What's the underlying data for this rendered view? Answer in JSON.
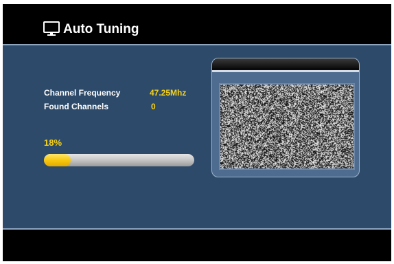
{
  "header": {
    "title": "Auto Tuning",
    "icon": "tv-icon"
  },
  "scan": {
    "frequency_label": "Channel Frequency",
    "frequency_value": "47.25Mhz",
    "found_label": "Found Channels",
    "found_value": "0",
    "progress_text": "18%",
    "progress_fraction": 0.18
  },
  "preview": {
    "content": "static-noise"
  },
  "colors": {
    "background_panel": "#2d4a6a",
    "accent_yellow": "#f7d21a",
    "bar_black": "#000000"
  }
}
